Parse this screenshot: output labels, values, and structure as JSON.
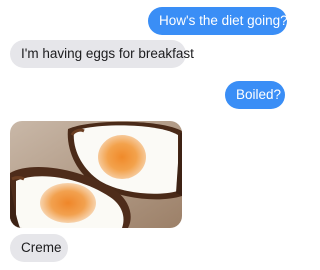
{
  "conversation": {
    "messages": [
      {
        "direction": "sent",
        "text": "How's the diet going?"
      },
      {
        "direction": "received",
        "text": "I'm having eggs for breakfast"
      },
      {
        "direction": "sent",
        "text": "Boiled?"
      },
      {
        "direction": "received",
        "type": "photo"
      },
      {
        "direction": "received",
        "text": "Creme"
      }
    ]
  },
  "colors": {
    "sent_bubble": "#3a8ef6",
    "received_bubble": "#e6e6ea"
  }
}
